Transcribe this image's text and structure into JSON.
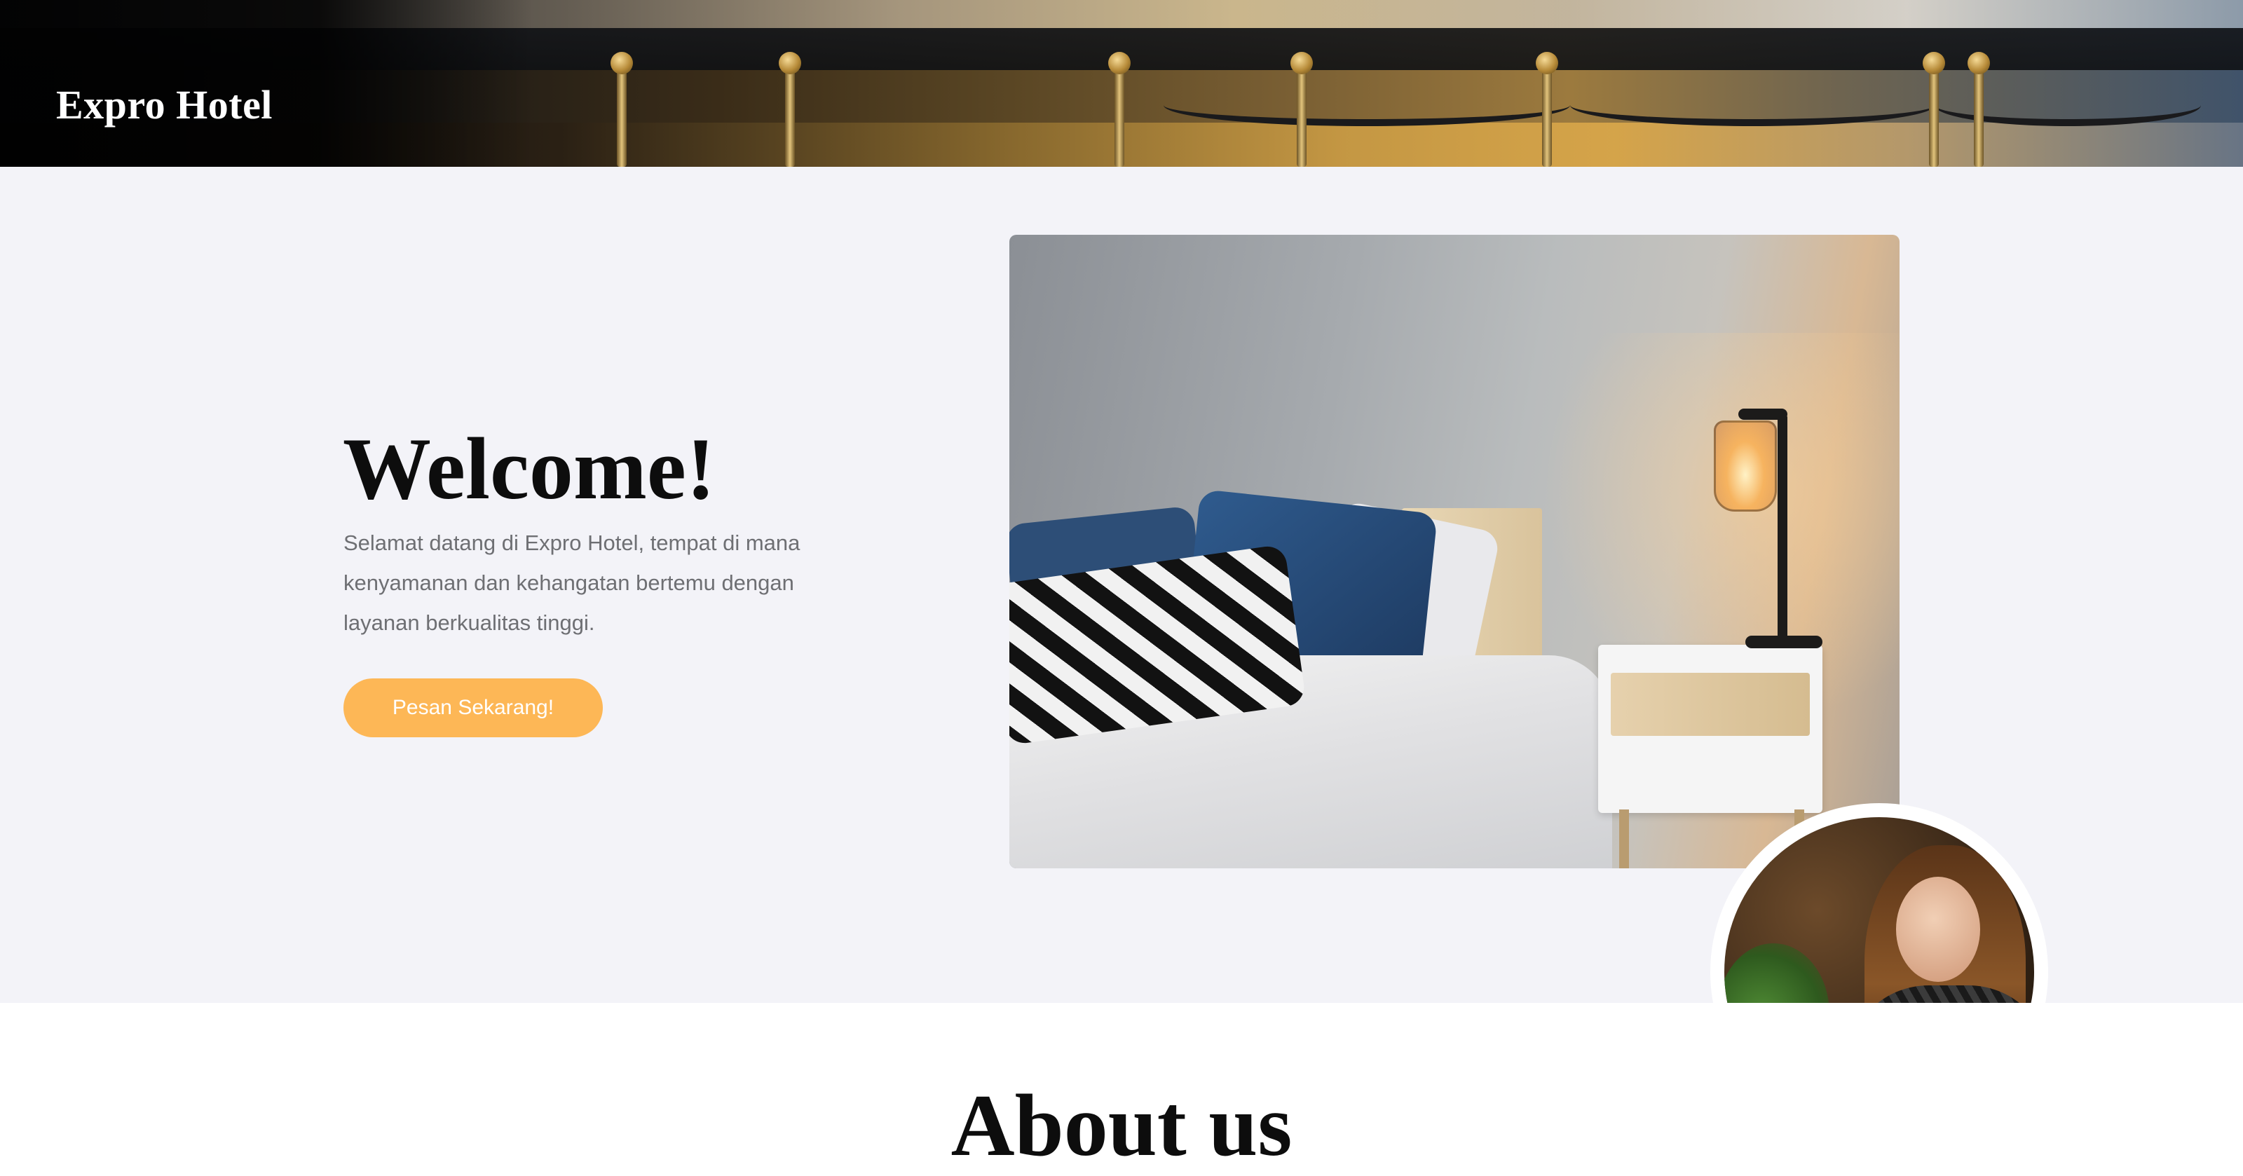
{
  "header": {
    "brand": "Expro Hotel"
  },
  "hero": {
    "title": "Welcome!",
    "description": "Selamat datang di Expro Hotel, tempat di mana kenyamanan dan kehangatan bertemu dengan layanan berkualitas tinggi.",
    "cta_label": "Pesan Sekarang!"
  },
  "about": {
    "title": "About us"
  },
  "colors": {
    "hero_background": "#f3f3f8",
    "cta_background": "#fdb756",
    "cta_text": "#ffffff",
    "body_text": "#6e6f73",
    "heading_text": "#0d0d0d"
  }
}
